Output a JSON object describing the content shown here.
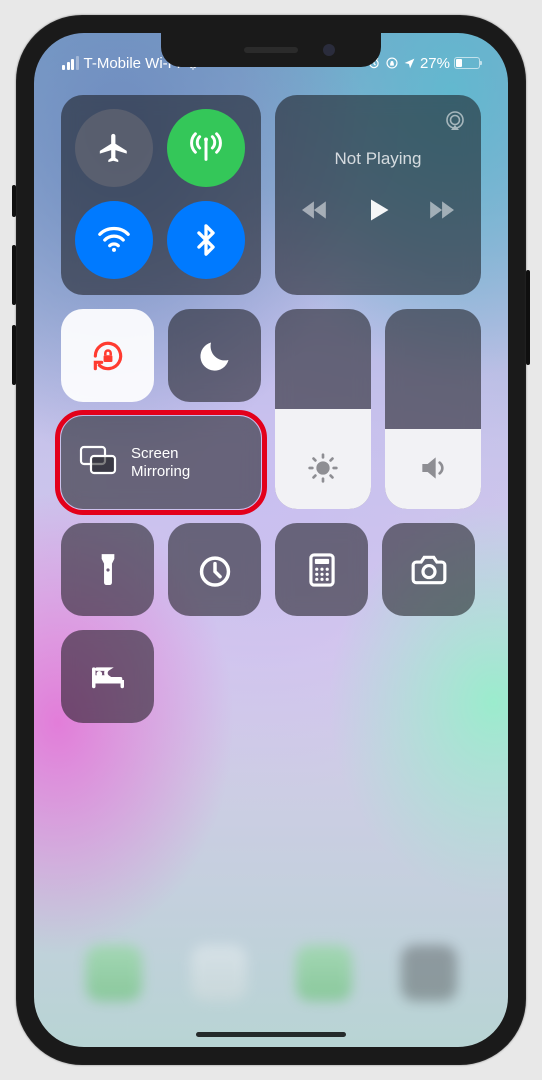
{
  "status": {
    "carrier": "T-Mobile Wi-Fi",
    "battery_pct": "27%"
  },
  "media": {
    "now_playing": "Not Playing"
  },
  "screen_mirroring": {
    "label_line1": "Screen",
    "label_line2": "Mirroring"
  },
  "toggles": {
    "airplane": false,
    "cellular": true,
    "wifi": true,
    "bluetooth": true,
    "orientation_lock": true,
    "dnd": false
  },
  "sliders": {
    "brightness_pct": 50,
    "volume_pct": 40
  },
  "colors": {
    "active_green": "#34c759",
    "active_blue": "#007aff",
    "highlight": "#e3001b",
    "lock_tint": "#ff3b30"
  }
}
